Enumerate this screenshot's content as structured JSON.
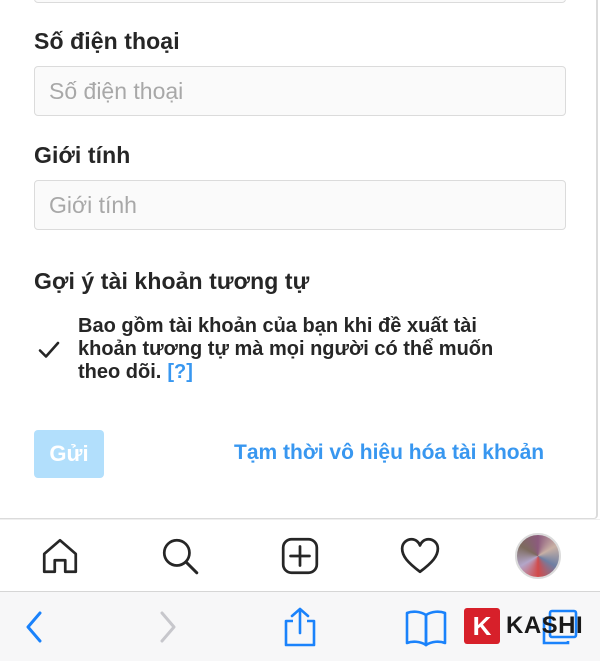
{
  "form": {
    "phone": {
      "label": "Số điện thoại",
      "placeholder": "Số điện thoại",
      "value": ""
    },
    "gender": {
      "label": "Giới tính",
      "placeholder": "Giới tính",
      "value": ""
    },
    "similar_accounts": {
      "heading": "Gợi ý tài khoản tương tự",
      "checkbox_checked": true,
      "checkbox_text": "Bao gồm tài khoản của bạn khi đề xuất tài khoản tương tự mà mọi người có thể muốn theo dõi.",
      "help_link": "[?]"
    },
    "submit_label": "Gửi",
    "deactivate_label": "Tạm thời vô hiệu hóa tài khoản"
  },
  "tab_bar": {
    "items": [
      "home-icon",
      "search-icon",
      "new-post-icon",
      "activity-heart-icon",
      "profile-avatar"
    ]
  },
  "browser_toolbar": {
    "items": [
      "back-icon",
      "forward-icon",
      "share-icon",
      "bookmarks-icon",
      "tabs-icon"
    ]
  },
  "watermark": {
    "badge": "K",
    "text": "KASHI"
  },
  "colors": {
    "link_blue": "#3897f0",
    "button_disabled": "#b2dffc",
    "input_border": "#dbdbdb",
    "text_dark": "#262626",
    "placeholder": "#a8a8a8",
    "watermark_red": "#d7202a"
  }
}
